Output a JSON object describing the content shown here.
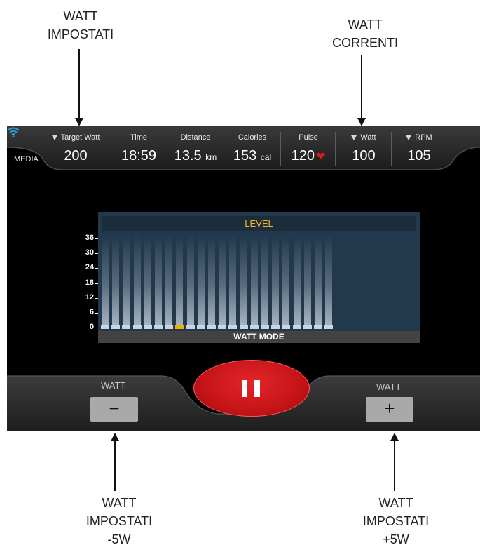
{
  "annotations": {
    "top_left": [
      "WATT",
      "IMPOSTATI"
    ],
    "top_right": [
      "WATT",
      "CORRENTI"
    ],
    "bottom_left": [
      "WATT",
      "IMPOSTATI",
      "-5W"
    ],
    "bottom_right": [
      "WATT",
      "IMPOSTATI",
      "+5W"
    ]
  },
  "statusbar": {
    "media_label": "MEDIA",
    "stats": [
      {
        "label": "Target Watt",
        "value": "200",
        "unit": "",
        "arrow": true
      },
      {
        "label": "Time",
        "value": "18:59",
        "unit": "",
        "arrow": false
      },
      {
        "label": "Distance",
        "value": "13.5",
        "unit": "km",
        "arrow": false
      },
      {
        "label": "Calories",
        "value": "153",
        "unit": "cal",
        "arrow": false
      },
      {
        "label": "Pulse",
        "value": "120",
        "unit": "",
        "arrow": false
      },
      {
        "label": "Watt",
        "value": "100",
        "unit": "",
        "arrow": true
      },
      {
        "label": "RPM",
        "value": "105",
        "unit": "",
        "arrow": true
      }
    ],
    "icons": {
      "pulse": "heart-icon",
      "wireless": "wifi-icon"
    },
    "colors": {
      "wifi": "#1fa8e6",
      "heart": "#e01818"
    }
  },
  "chart": {
    "title": "LEVEL",
    "mode_label": "WATT MODE",
    "y_ticks": [
      "36",
      "30",
      "24",
      "18",
      "12",
      "6",
      "0"
    ],
    "columns": 22,
    "active_column": 7,
    "colors": {
      "active": "#f0b000",
      "title": "#f3b626",
      "background": "#22384c"
    }
  },
  "controls": {
    "minus": {
      "label": "WATT",
      "symbol": "−"
    },
    "plus": {
      "label": "WATT",
      "symbol": "+"
    },
    "pause_icon": "pause-icon",
    "pause_color": "#c51418"
  }
}
